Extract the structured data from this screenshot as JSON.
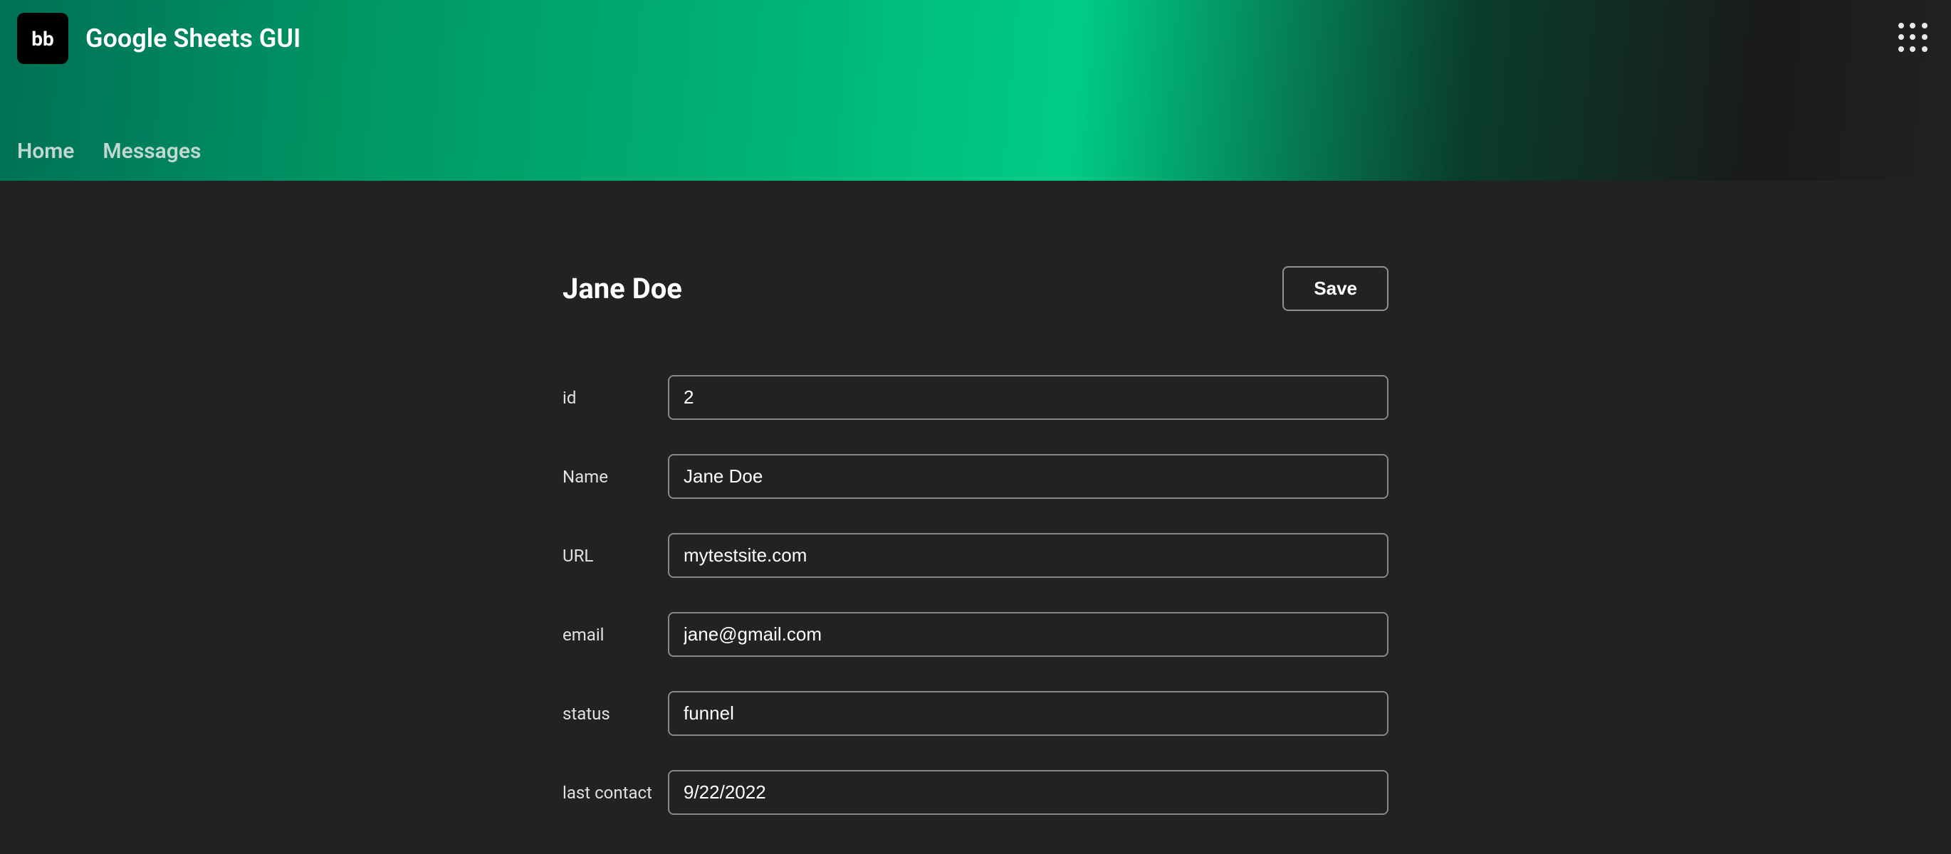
{
  "header": {
    "app_title": "Google Sheets GUI",
    "logo_text": "bb"
  },
  "nav": {
    "home": "Home",
    "messages": "Messages"
  },
  "page": {
    "title": "Jane Doe",
    "save_button": "Save"
  },
  "form": {
    "fields": [
      {
        "label": "id",
        "value": "2"
      },
      {
        "label": "Name",
        "value": "Jane Doe"
      },
      {
        "label": "URL",
        "value": "mytestsite.com"
      },
      {
        "label": "email",
        "value": "jane@gmail.com"
      },
      {
        "label": "status",
        "value": "funnel"
      },
      {
        "label": "last contact",
        "value": "9/22/2022"
      }
    ]
  }
}
